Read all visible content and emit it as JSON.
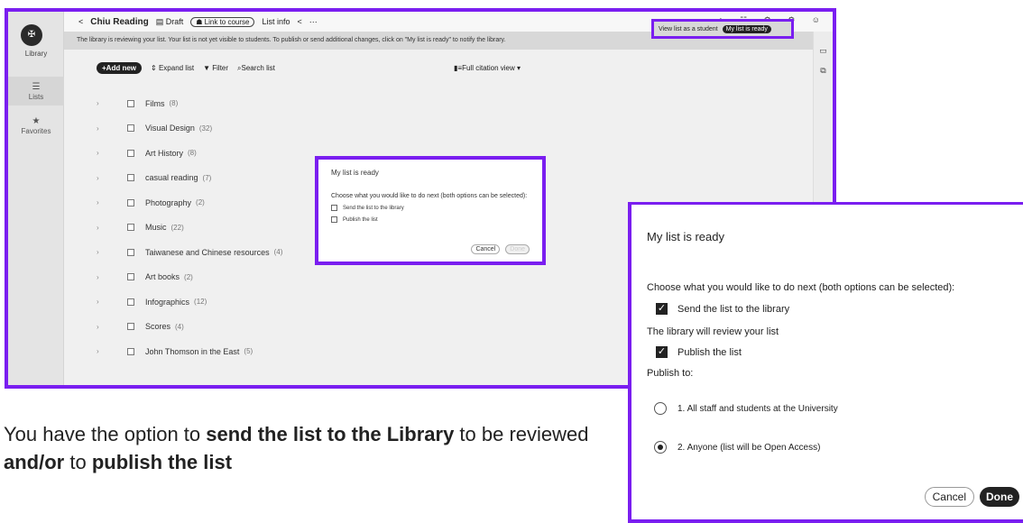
{
  "app": {
    "logo_label": "Library",
    "rail": {
      "lists": "Lists",
      "favorites": "Favorites"
    },
    "topbar": {
      "back": "<",
      "title": "Chiu Reading",
      "draft": "Draft",
      "link_course": "Link to course",
      "list_info": "List info",
      "share": "<",
      "more": "⋯",
      "icons": "⌂ ☷ ⚙ ⚙ ☺"
    },
    "notice": {
      "text": "The library is reviewing your list. Your list is not yet visible to students. To publish or send additional changes, click on \"My list is ready\" to notify the library.",
      "view_student": "View list as a student",
      "ready": "My list is ready"
    },
    "toolbar": {
      "add": "+Add new",
      "expand": "Expand list",
      "filter": "Filter",
      "search": "Search list",
      "citation": "Full citation view ▾"
    },
    "sections": [
      {
        "name": "Films",
        "count": "(8)"
      },
      {
        "name": "Visual Design",
        "count": "(32)"
      },
      {
        "name": "Art History",
        "count": "(8)"
      },
      {
        "name": "casual reading",
        "count": "(7)"
      },
      {
        "name": "Photography",
        "count": "(2)"
      },
      {
        "name": "Music",
        "count": "(22)"
      },
      {
        "name": "Taiwanese and Chinese resources",
        "count": "(4)"
      },
      {
        "name": "Art books",
        "count": "(2)"
      },
      {
        "name": "Infographics",
        "count": "(12)"
      },
      {
        "name": "Scores",
        "count": "(4)"
      },
      {
        "name": "John Thomson in the East",
        "count": "(5)"
      }
    ],
    "mini_dialog": {
      "title": "My list is ready",
      "instruction": "Choose what you would like to do next (both options can be selected):",
      "opt_send": "Send the list to the library",
      "opt_publish": "Publish the list",
      "cancel": "Cancel",
      "done": "Done"
    }
  },
  "dialog": {
    "title": "My list is ready",
    "instruction": "Choose what you would like to do next (both options can be selected):",
    "send_label": "Send the list to the library",
    "send_checked": true,
    "review_note": "The library will review your list",
    "publish_label": "Publish the list",
    "publish_checked": true,
    "publish_to": "Publish to:",
    "option1": "1. All staff and students at the University",
    "option2": "2. Anyone (list will be Open Access)",
    "selected_option": 2,
    "cancel": "Cancel",
    "done": "Done"
  },
  "caption": {
    "p1": "You have the option to ",
    "b1": "send the list to the Library",
    "p2": " to be reviewed ",
    "b2": "and/or",
    "p3": " to ",
    "b3": "publish the list"
  },
  "colors": {
    "highlight": "#7a1ef0",
    "primary_button": "#222222"
  }
}
